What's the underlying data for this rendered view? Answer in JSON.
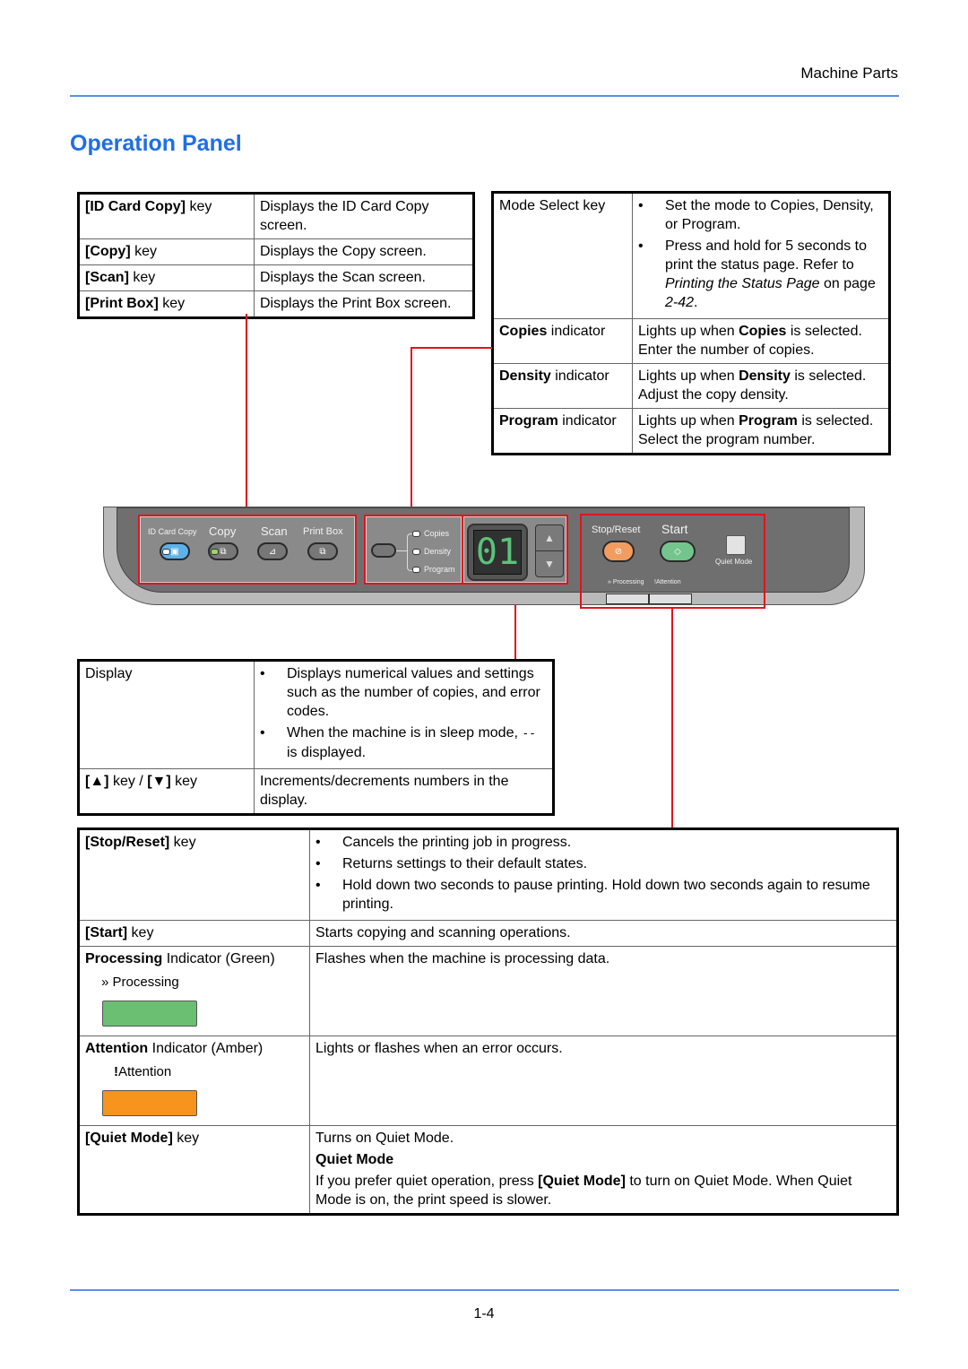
{
  "header": {
    "section": "Machine Parts"
  },
  "page_title": "Operation Panel",
  "footer": {
    "page_number": "1-4"
  },
  "colors": {
    "title_blue": "#1f6fe5",
    "rule_blue": "#5b8fe8",
    "callout_red": "#e0141e",
    "processing_green": "#6abf72",
    "attention_amber": "#f7941d"
  },
  "table_mode_keys": {
    "rows": [
      {
        "key_bold": "[ID Card Copy]",
        "key_rest": " key",
        "desc": "Displays the ID Card Copy screen."
      },
      {
        "key_bold": "[Copy]",
        "key_rest": " key",
        "desc": "Displays the Copy screen."
      },
      {
        "key_bold": "[Scan]",
        "key_rest": " key",
        "desc": "Displays the Scan screen."
      },
      {
        "key_bold": "[Print Box]",
        "key_rest": " key",
        "desc": "Displays the Print Box screen."
      }
    ]
  },
  "table_mode_select": {
    "mode_select": {
      "key": "Mode Select key",
      "bullets": [
        "Set the mode to Copies, Density, or Program.",
        {
          "before": "Press and hold for 5 seconds to print the status page. Refer to ",
          "italic": "Printing the Status Page",
          "middle": " on page ",
          "italic2": "2-42",
          "after": "."
        }
      ]
    },
    "indicators": [
      {
        "key_bold": "Copies",
        "key_rest": " indicator",
        "desc_before": "Lights up when ",
        "desc_bold": "Copies",
        "desc_after": " is selected. Enter the number of copies."
      },
      {
        "key_bold": "Density",
        "key_rest": " indicator",
        "desc_before": "Lights up when ",
        "desc_bold": "Density",
        "desc_after": " is selected. Adjust the copy density."
      },
      {
        "key_bold": "Program",
        "key_rest": " indicator",
        "desc_before": "Lights up when ",
        "desc_bold": "Program",
        "desc_after": " is selected. Select the program number."
      }
    ]
  },
  "panel": {
    "mode_keys": [
      "ID Card Copy",
      "Copy",
      "Scan",
      "Print Box"
    ],
    "mode_indicators": [
      "Copies",
      "Density",
      "Program"
    ],
    "display_value": "01",
    "up_arrow": "▲",
    "down_arrow": "▼",
    "stop_reset": "Stop/Reset",
    "start": "Start",
    "quiet_mode": "Quiet Mode",
    "processing": "Processing",
    "attention": "Attention"
  },
  "table_display": {
    "display": {
      "key": "Display",
      "bullets": [
        "Displays numerical values and settings such as the number of copies, and error codes.",
        {
          "before": "When the machine is in sleep mode, ",
          "mono": "--",
          "after": " is displayed."
        }
      ]
    },
    "arrows": {
      "up": "[▲]",
      "mid": " key / ",
      "down": "[▼]",
      "rest": " key",
      "desc": "Increments/decrements numbers in the display."
    }
  },
  "table_right_keys": {
    "stop_reset": {
      "key_bold": "[Stop/Reset]",
      "key_rest": " key",
      "bullets": [
        "Cancels the printing job in progress.",
        "Returns settings to their default states.",
        "Hold down two seconds to pause printing. Hold down two seconds again to resume printing."
      ]
    },
    "start": {
      "key_bold": "[Start]",
      "key_rest": " key",
      "desc": "Starts copying and scanning operations."
    },
    "processing": {
      "key_bold": "Processing",
      "key_rest": " Indicator (Green)",
      "icon_label": "Processing",
      "desc": "Flashes when the machine is processing data."
    },
    "attention": {
      "key_bold": "Attention",
      "key_rest": " Indicator (Amber)",
      "icon_label": "Attention",
      "desc": "Lights or flashes when an error occurs."
    },
    "quiet_mode": {
      "key_bold": "[Quiet Mode]",
      "key_rest": " key",
      "desc": "Turns on Quiet Mode.",
      "note_title": "Quiet Mode",
      "note_before": "If you prefer quiet operation, press ",
      "note_bold": "[Quiet Mode]",
      "note_after": " to turn on Quiet Mode. When Quiet Mode is on, the print speed is slower."
    }
  }
}
